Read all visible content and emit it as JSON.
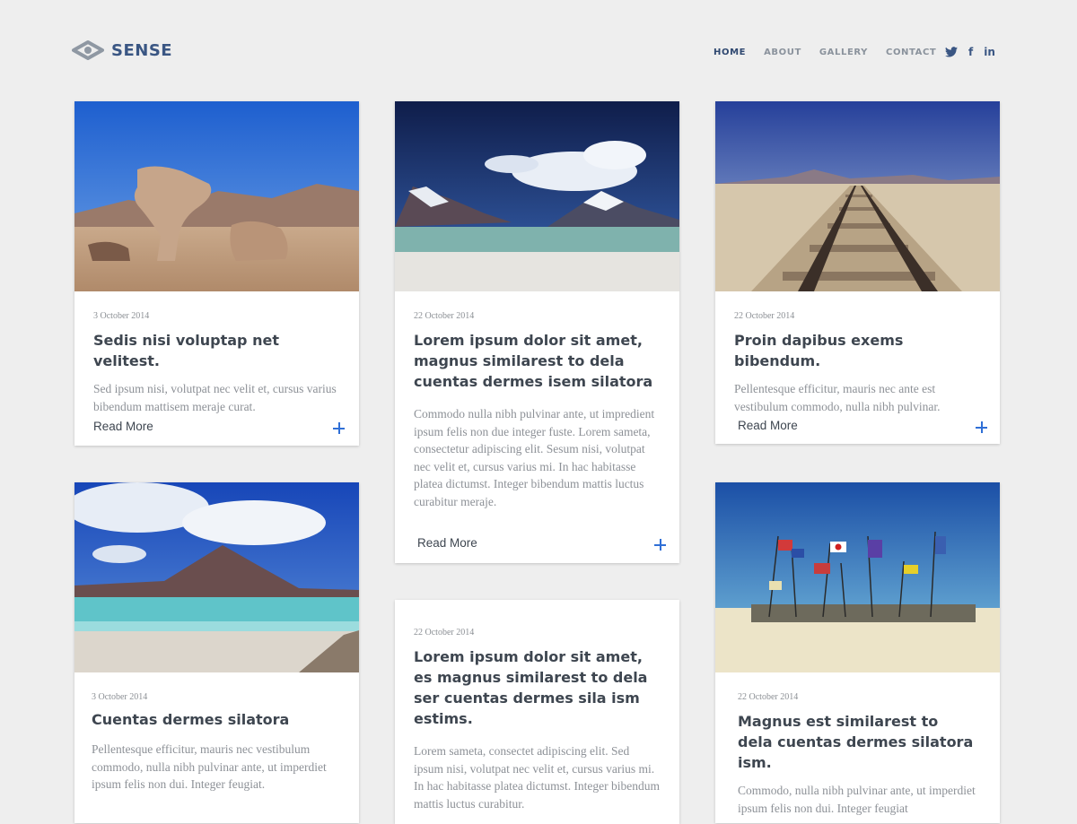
{
  "brand": {
    "name": "SENSE"
  },
  "nav": {
    "items": [
      "HOME",
      "ABOUT",
      "GALLERY",
      "CONTACT"
    ],
    "active": "HOME"
  },
  "social": {
    "icons": [
      "twitter-icon",
      "facebook-icon",
      "linkedin-icon"
    ],
    "facebook_glyph": "f",
    "linkedin_glyph": "in"
  },
  "colors": {
    "accent": "#2f6fd6",
    "brand": "#3a5683",
    "background": "#eeeeee"
  },
  "read_more_label": "Read More",
  "cards": [
    {
      "image": "desert-rock-photo",
      "date": "3 October 2014",
      "title": "Sedis nisi voluptap net velitest.",
      "excerpt": "Sed ipsum nisi, volutpat nec velit et, cursus varius bibendum mattisem meraje curat."
    },
    {
      "image": "snowy-mountain-lake-photo",
      "date": "22 October 2014",
      "title": "Lorem ipsum dolor sit amet, magnus similarest to dela cuentas dermes isem silatora",
      "excerpt": "Commodo nulla nibh pulvinar ante, ut impredient ipsum felis non due integer fuste. Lorem sameta, consectetur adipiscing elit. Sesum nisi, volutpat nec velit et, cursus varius mi. In hac habitasse platea dictumst. Integer bibendum mattis luctus curabitur meraje."
    },
    {
      "image": "railway-desert-photo",
      "date": "22 October 2014",
      "title": "Proin dapibus exems bibendum.",
      "excerpt": "Pellentesque efficitur, mauris nec ante est vestibulum commodo, nulla nibh pulvinar."
    },
    {
      "image": "volcano-lagoon-photo",
      "date": "3 October 2014",
      "title": "Cuentas dermes silatora",
      "excerpt": "Pellentesque efficitur, mauris nec vestibulum commodo, nulla nibh pulvinar ante, ut imperdiet ipsum felis non dui. Integer feugiat."
    },
    {
      "date": "22 October 2014",
      "title": "Lorem ipsum dolor sit amet, es magnus similarest to dela ser cuentas dermes sila ism estims.",
      "excerpt": "Lorem sameta, consectet adipiscing elit. Sed ipsum nisi, volutpat nec velit et, cursus varius mi. In hac habitasse platea dictumst. Integer bibendum mattis luctus curabitur."
    },
    {
      "image": "salt-flat-flags-photo",
      "date": "22 October 2014",
      "title": "Magnus est similarest to dela cuentas dermes silatora ism.",
      "excerpt": "Commodo, nulla nibh pulvinar ante, ut imperdiet ipsum felis non dui. Integer feugiat"
    }
  ]
}
